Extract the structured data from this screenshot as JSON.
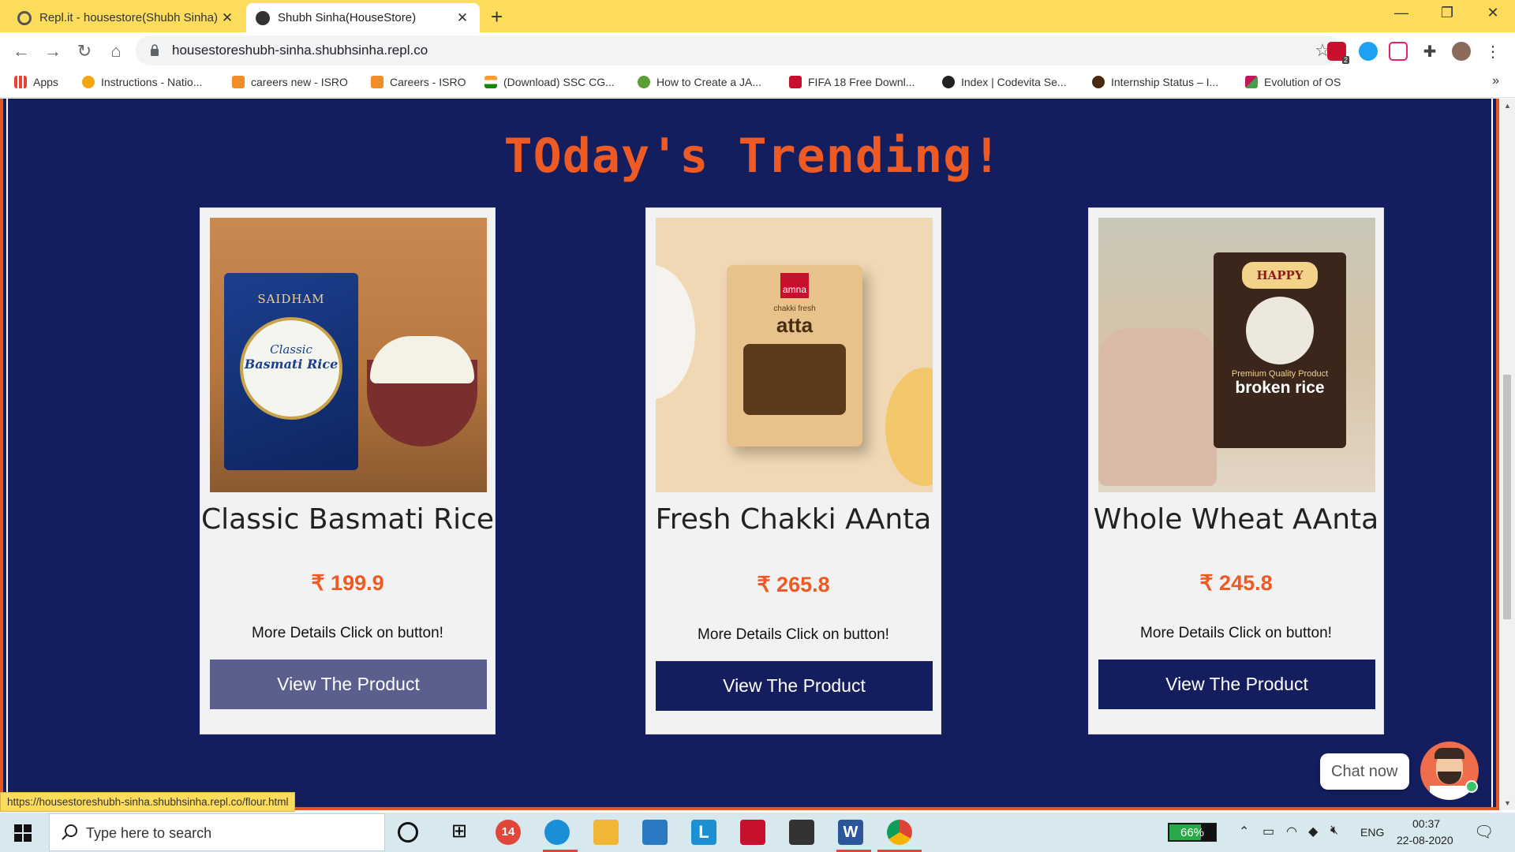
{
  "browser": {
    "tabs": [
      {
        "label": "Repl.it - housestore(Shubh Sinha)",
        "active": false
      },
      {
        "label": "Shubh Sinha(HouseStore)",
        "active": true
      }
    ],
    "url": "housestoreshubh-sinha.shubhsinha.repl.co",
    "extension_badge": "2",
    "bookmarks": [
      {
        "label": "Apps",
        "icon": "apps-grid-icon"
      },
      {
        "label": "Instructions - Natio...",
        "icon": "bulb-icon"
      },
      {
        "label": "careers new - ISRO",
        "icon": "isro-icon"
      },
      {
        "label": "Careers - ISRO",
        "icon": "isro-icon"
      },
      {
        "label": "(Download) SSC CG...",
        "icon": "india-flag-icon"
      },
      {
        "label": "How to Create a JA...",
        "icon": "site-icon"
      },
      {
        "label": "FIFA 18 Free Downl...",
        "icon": "gamepad-icon"
      },
      {
        "label": "Index | Codevita Se...",
        "icon": "globe-icon"
      },
      {
        "label": "Internship Status – I...",
        "icon": "site-icon"
      },
      {
        "label": "Evolution of OS",
        "icon": "site-icon"
      }
    ],
    "status_url": "https://housestoreshubh-sinha.shubhsinha.repl.co/flour.html"
  },
  "page": {
    "heading": "TOday's Trending!",
    "products": [
      {
        "name": "Classic Basmati Rice",
        "price": "₹ 199.9",
        "details": "More Details Click on button!",
        "button": "View The Product",
        "image_brand": "SAIDHAM",
        "image_line1": "Classic",
        "image_line2": "Basmati Rice"
      },
      {
        "name": "Fresh Chakki AAnta",
        "price": "₹ 265.8",
        "details": "More Details Click on button!",
        "button": "View The Product",
        "image_brand": "amna",
        "image_line1": "chakki fresh",
        "image_line2": "atta"
      },
      {
        "name": "Whole Wheat AAnta",
        "price": "₹ 245.8",
        "details": "More Details Click on button!",
        "button": "View The Product",
        "image_brand": "HAPPY",
        "image_line1": "Premium Quality Product",
        "image_line2": "broken rice"
      }
    ],
    "chat_label": "Chat now"
  },
  "taskbar": {
    "search_placeholder": "Type here to search",
    "mail_badge": "14",
    "battery_percent": "66%",
    "language": "ENG",
    "time": "00:37",
    "date": "22-08-2020"
  },
  "colors": {
    "accent": "#ee5a24",
    "page_bg": "#141e5e",
    "titlebar": "#fddc5c"
  }
}
